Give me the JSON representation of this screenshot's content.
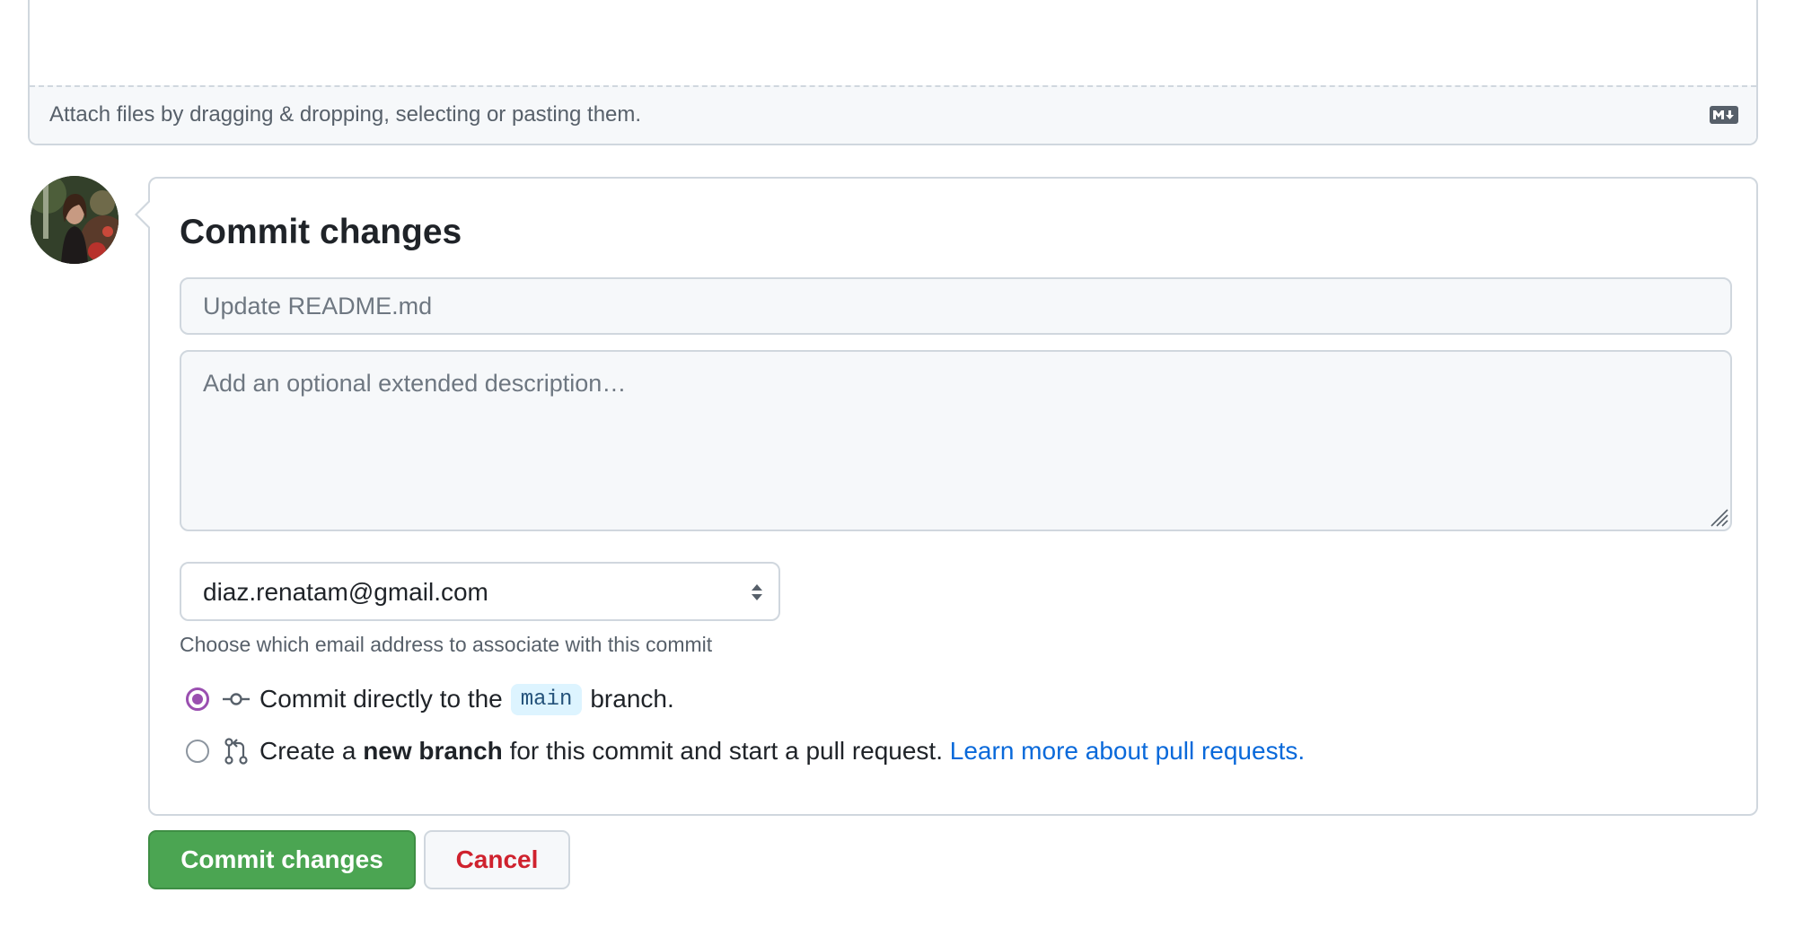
{
  "editor": {
    "attach_hint": "Attach files by dragging & dropping, selecting or pasting them.",
    "markdown_icon": "markdown-icon"
  },
  "commit": {
    "avatar_icon": "user-avatar",
    "title": "Commit changes",
    "summary_placeholder": "Update README.md",
    "summary_value": "",
    "description_placeholder": "Add an optional extended description…",
    "description_value": "",
    "email": {
      "selected": "diaz.renatam@gmail.com",
      "hint": "Choose which email address to associate with this commit"
    },
    "options": {
      "direct": {
        "selected": true,
        "icon": "git-commit-icon",
        "text_before": "Commit directly to the",
        "branch": "main",
        "text_after": "branch."
      },
      "new_branch": {
        "selected": false,
        "icon": "git-pull-request-icon",
        "text_before": "Create a",
        "bold_text": "new branch",
        "text_after": "for this commit and start a pull request.",
        "link": "Learn more about pull requests."
      }
    }
  },
  "actions": {
    "commit_label": "Commit changes",
    "cancel_label": "Cancel"
  },
  "colors": {
    "primary_button": "#4ba552",
    "cancel_text": "#cf222e",
    "link": "#0969da",
    "radio_checked": "#9a4fb0",
    "branch_badge_bg": "#ddf4ff"
  }
}
